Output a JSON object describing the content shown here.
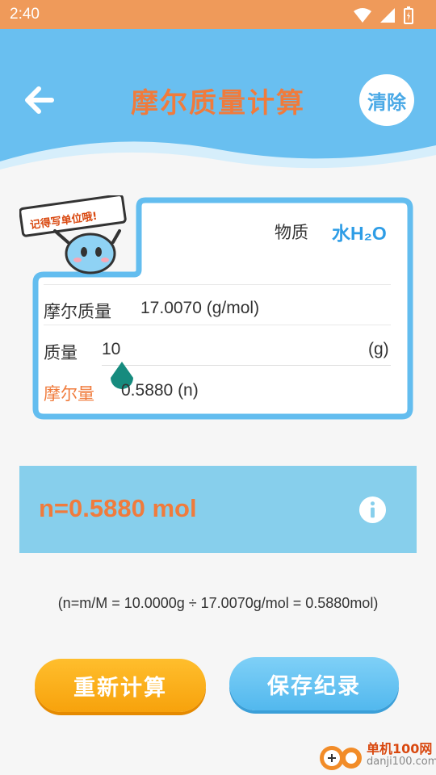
{
  "status_bar": {
    "time": "2:40"
  },
  "header": {
    "title": "摩尔质量计算",
    "clear_label": "清除"
  },
  "card": {
    "badge_text": "记得写单位哦!",
    "substance_label": "物质",
    "substance_value": "水H₂O",
    "molar_mass_label": "摩尔质量",
    "molar_mass_value": "17.0070 (g/mol)",
    "mass_label": "质量",
    "mass_value": "10",
    "mass_unit": "(g)",
    "moles_label": "摩尔量",
    "moles_value": "0.5880 (n)"
  },
  "result": {
    "text": "n=0.5880 mol"
  },
  "formula": "(n=m/M = 10.0000g ÷ 17.0070g/mol = 0.5880mol)",
  "buttons": {
    "recalculate": "重新计算",
    "save": "保存纪录"
  },
  "watermark": {
    "line1": "单机100网",
    "line2": "danji100.com"
  },
  "colors": {
    "header": "#69bff0",
    "accent_orange": "#f07b3c",
    "accent_blue": "#2e9de6",
    "result_bg": "#87cfec"
  }
}
